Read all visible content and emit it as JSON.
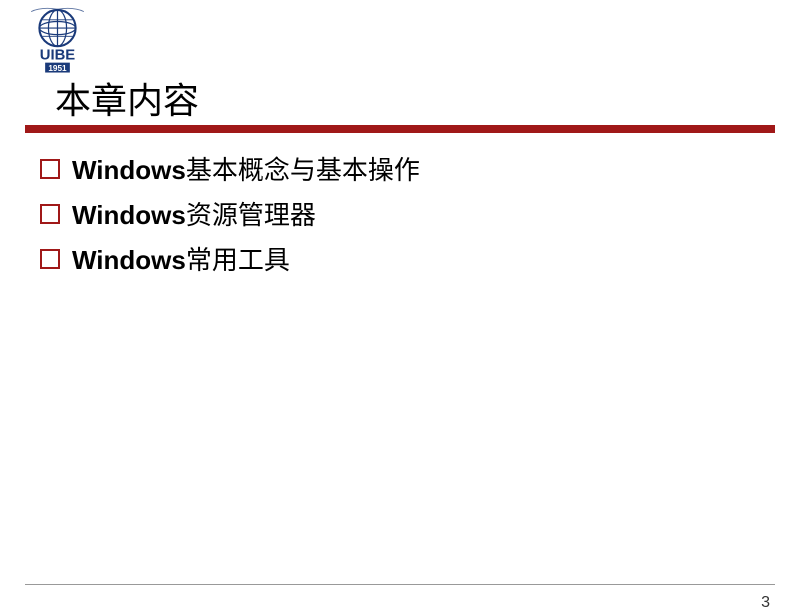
{
  "logo": {
    "text_top": "UIBE",
    "text_bottom": "1951",
    "color": "#1a3a7a"
  },
  "title": "本章内容",
  "items": [
    {
      "bold": "Windows",
      "rest": "基本概念与基本操作"
    },
    {
      "bold": "Windows",
      "rest": "资源管理器"
    },
    {
      "bold": "Windows",
      "rest": "常用工具"
    }
  ],
  "page_number": "3"
}
